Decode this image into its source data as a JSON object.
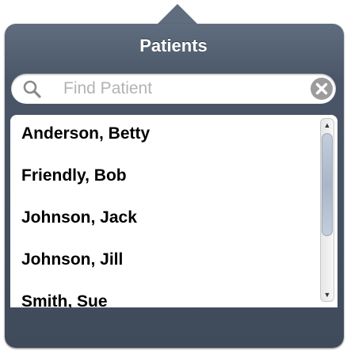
{
  "popover": {
    "title": "Patients"
  },
  "search": {
    "placeholder": "Find Patient",
    "value": ""
  },
  "patients": [
    {
      "name": "Anderson, Betty"
    },
    {
      "name": "Friendly, Bob"
    },
    {
      "name": "Johnson, Jack"
    },
    {
      "name": "Johnson, Jill"
    },
    {
      "name": "Smith, Sue"
    }
  ],
  "icons": {
    "search": "search-icon",
    "clear": "clear-icon",
    "scroll_up": "arrow-up-icon",
    "scroll_down": "arrow-down-icon"
  },
  "colors": {
    "header": "#5f6d7e",
    "body": "#3f4b5b",
    "thumb": "#b4c1d1"
  }
}
